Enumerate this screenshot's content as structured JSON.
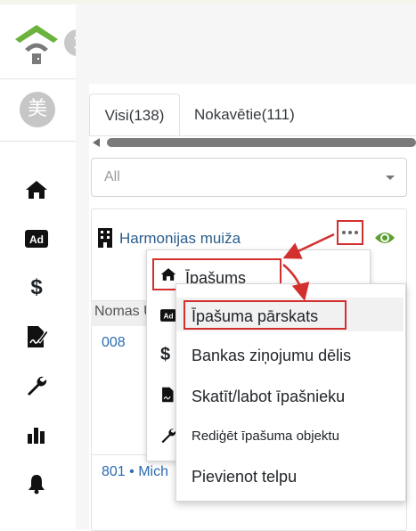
{
  "sidebar": {
    "avatar_text": "美",
    "items": [
      {
        "icon": "home-icon"
      },
      {
        "icon": "ad-icon",
        "text": "Ad"
      },
      {
        "icon": "dollar-icon",
        "text": "$"
      },
      {
        "icon": "contract-icon"
      },
      {
        "icon": "wrench-icon"
      },
      {
        "icon": "bar-chart-icon"
      },
      {
        "icon": "bell-icon"
      }
    ]
  },
  "tabs": [
    {
      "label": "Visi(138)",
      "active": true
    },
    {
      "label": "Nokavētie(111)",
      "active": false
    }
  ],
  "filter": {
    "value": "All"
  },
  "property": {
    "name": "Harmonijas muiža",
    "table_header": "Nomas U",
    "rows": [
      "008",
      "801 • Mich"
    ]
  },
  "menu_primary": {
    "item_label": "Īpašums",
    "hidden_icons": [
      {
        "icon": "ad-icon",
        "text": "Ad"
      },
      {
        "icon": "dollar-icon",
        "text": "$"
      },
      {
        "icon": "contract-icon"
      },
      {
        "icon": "wrench-icon"
      }
    ]
  },
  "menu_secondary": {
    "items": [
      "Īpašuma pārskats",
      "Bankas ziņojumu dēlis",
      "Skatīt/labot īpašnieku",
      "Rediģēt īpašuma objektu",
      "Pievienot telpu"
    ]
  },
  "colors": {
    "annotation": "#d22f2f",
    "link": "#2b5d8c",
    "eye": "#5c9e31",
    "logo_green": "#6bb33e"
  }
}
